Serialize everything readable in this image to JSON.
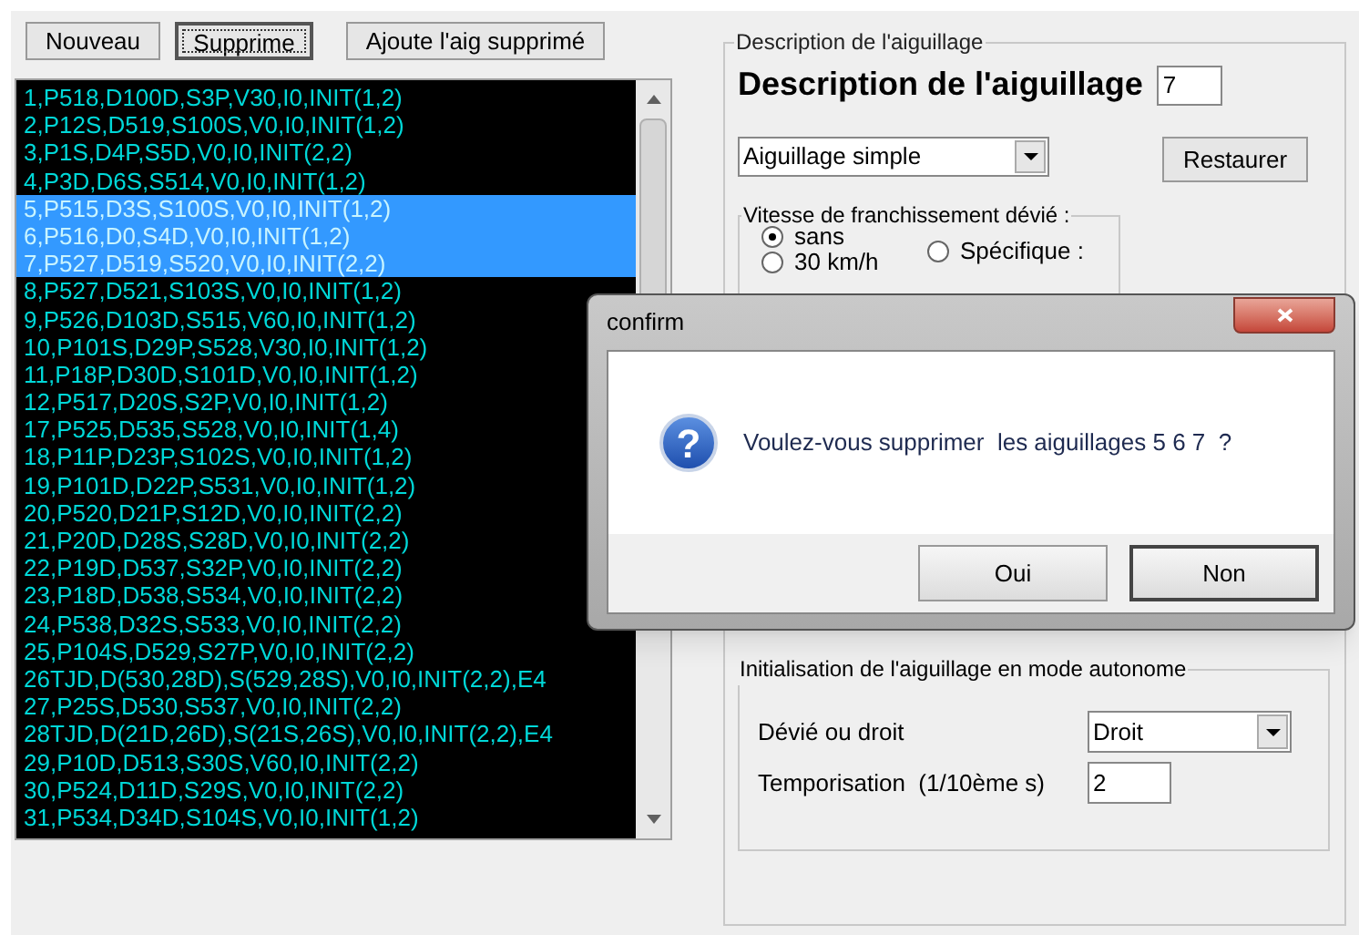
{
  "toolbar": {
    "buttons": [
      {
        "label": "Nouveau",
        "focused": false
      },
      {
        "label": "Supprime",
        "focused": true
      },
      {
        "label": "Ajoute l'aig supprimé",
        "focused": false
      }
    ]
  },
  "list": {
    "items": [
      {
        "text": "1,P518,D100D,S3P,V30,I0,INIT(1,2)",
        "selected": false
      },
      {
        "text": "2,P12S,D519,S100S,V0,I0,INIT(1,2)",
        "selected": false
      },
      {
        "text": "3,P1S,D4P,S5D,V0,I0,INIT(2,2)",
        "selected": false
      },
      {
        "text": "4,P3D,D6S,S514,V0,I0,INIT(1,2)",
        "selected": false
      },
      {
        "text": "5,P515,D3S,S100S,V0,I0,INIT(1,2)",
        "selected": true
      },
      {
        "text": "6,P516,D0,S4D,V0,I0,INIT(1,2)",
        "selected": true
      },
      {
        "text": "7,P527,D519,S520,V0,I0,INIT(2,2)",
        "selected": true
      },
      {
        "text": "8,P527,D521,S103S,V0,I0,INIT(1,2)",
        "selected": false
      },
      {
        "text": "9,P526,D103D,S515,V60,I0,INIT(1,2)",
        "selected": false
      },
      {
        "text": "10,P101S,D29P,S528,V30,I0,INIT(1,2)",
        "selected": false
      },
      {
        "text": "11,P18P,D30D,S101D,V0,I0,INIT(1,2)",
        "selected": false
      },
      {
        "text": "12,P517,D20S,S2P,V0,I0,INIT(1,2)",
        "selected": false
      },
      {
        "text": "17,P525,D535,S528,V0,I0,INIT(1,4)",
        "selected": false
      },
      {
        "text": "18,P11P,D23P,S102S,V0,I0,INIT(1,2)",
        "selected": false
      },
      {
        "text": "19,P101D,D22P,S531,V0,I0,INIT(1,2)",
        "selected": false
      },
      {
        "text": "20,P520,D21P,S12D,V0,I0,INIT(2,2)",
        "selected": false
      },
      {
        "text": "21,P20D,D28S,S28D,V0,I0,INIT(2,2)",
        "selected": false
      },
      {
        "text": "22,P19D,D537,S32P,V0,I0,INIT(2,2)",
        "selected": false
      },
      {
        "text": "23,P18D,D538,S534,V0,I0,INIT(2,2)",
        "selected": false
      },
      {
        "text": "24,P538,D32S,S533,V0,I0,INIT(2,2)",
        "selected": false
      },
      {
        "text": "25,P104S,D529,S27P,V0,I0,INIT(2,2)",
        "selected": false
      },
      {
        "text": "26TJD,D(530,28D),S(529,28S),V0,I0,INIT(2,2),E4",
        "selected": false
      },
      {
        "text": "27,P25S,D530,S537,V0,I0,INIT(2,2)",
        "selected": false
      },
      {
        "text": "28TJD,D(21D,26D),S(21S,26S),V0,I0,INIT(2,2),E4",
        "selected": false
      },
      {
        "text": "29,P10D,D513,S30S,V60,I0,INIT(2,2)",
        "selected": false
      },
      {
        "text": "30,P524,D11D,S29S,V0,I0,INIT(2,2)",
        "selected": false
      },
      {
        "text": "31,P534,D34D,S104S,V0,I0,INIT(1,2)",
        "selected": false
      }
    ]
  },
  "description": {
    "group_title": "Description de l'aiguillage",
    "heading": "Description de l'aiguillage",
    "number": "7",
    "type_select": "Aiguillage simple",
    "restore_button": "Restaurer",
    "speed_group": {
      "title": "Vitesse de franchissement dévié :",
      "options": [
        {
          "label": "sans",
          "selected": true
        },
        {
          "label": "30 km/h",
          "selected": false
        },
        {
          "label": "Spécifique :",
          "selected": false
        }
      ]
    }
  },
  "init_group": {
    "title": "Initialisation de l'aiguillage en mode autonome",
    "fields": [
      {
        "kind": "select",
        "label": "Dévié ou droit",
        "value": "Droit"
      },
      {
        "kind": "input",
        "label": "Temporisation  (1/10ème s)",
        "value": "2"
      }
    ]
  },
  "dialog": {
    "title": "confirm",
    "icon_glyph": "?",
    "message": "Voulez-vous supprimer  les aiguillages 5 6 7  ?",
    "buttons": [
      {
        "label": "Oui",
        "focused": false
      },
      {
        "label": "Non",
        "focused": true
      }
    ]
  }
}
